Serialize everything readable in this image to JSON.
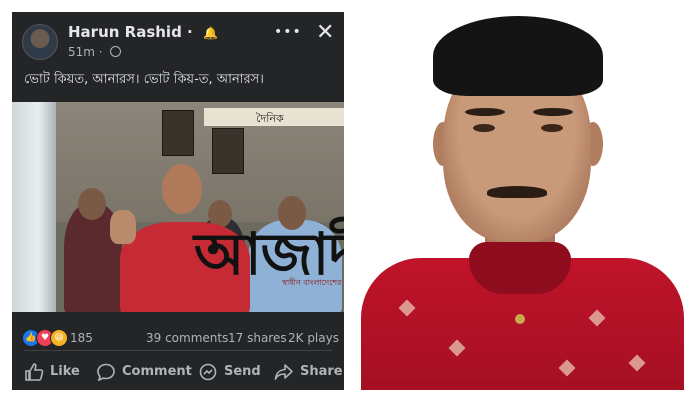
{
  "post": {
    "author": "Harun Rashid",
    "timestamp": "51m",
    "caption": "ভোট কিয়ত, আনারস। ভোট কিয়-ত, আনারস।",
    "video": {
      "sign_text": "দৈনিক",
      "watermark": "আজাদী",
      "watermark_tagline": "স্বাধীন বাংলাদেশের প্রথম সংবাদপত্র"
    },
    "stats": {
      "reaction_count": "185",
      "comments": "39 comments",
      "shares": "17 shares",
      "plays": "2K plays"
    },
    "actions": {
      "like": "Like",
      "comment": "Comment",
      "send": "Send",
      "share": "Share"
    },
    "icons": [
      "like-reaction-icon",
      "love-reaction-icon",
      "haha-reaction-icon",
      "globe-icon",
      "bell-icon",
      "more-icon",
      "close-icon",
      "like-icon",
      "comment-icon",
      "send-icon",
      "share-icon"
    ]
  },
  "colors": {
    "fb_dark": "#242526",
    "fb_text": "#e4e6eb",
    "fb_muted": "#b0b3b8",
    "like_blue": "#1877f2",
    "love_red": "#f33e58",
    "haha_yellow": "#f7b125",
    "shirt_red": "#c0142a"
  }
}
